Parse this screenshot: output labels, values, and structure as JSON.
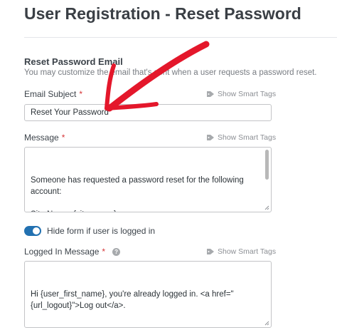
{
  "page": {
    "title": "User Registration - Reset Password"
  },
  "section": {
    "title": "Reset Password Email",
    "description": "You may customize the email that's sent when a user requests a password reset."
  },
  "email_subject": {
    "label": "Email Subject",
    "required": "*",
    "smart_tags": "Show Smart Tags",
    "value": "Reset Your Password"
  },
  "message": {
    "label": "Message",
    "required": "*",
    "smart_tags": "Show Smart Tags",
    "value": "Someone has requested a password reset for the following account:\n\nSite Name: {site_name}\n\nUsername: {user_registration_login}"
  },
  "hide_form": {
    "label": "Hide form if user is logged in",
    "enabled": true,
    "color": "#2271b1"
  },
  "logged_in_message": {
    "label": "Logged In Message",
    "required": "*",
    "help_icon": "question-circle-icon",
    "smart_tags": "Show Smart Tags",
    "value": "Hi {user_first_name}, you're already logged in. <a href=\"{url_logout}\">Log out</a>."
  },
  "annotation": {
    "arrow_color": "#e4172b"
  }
}
